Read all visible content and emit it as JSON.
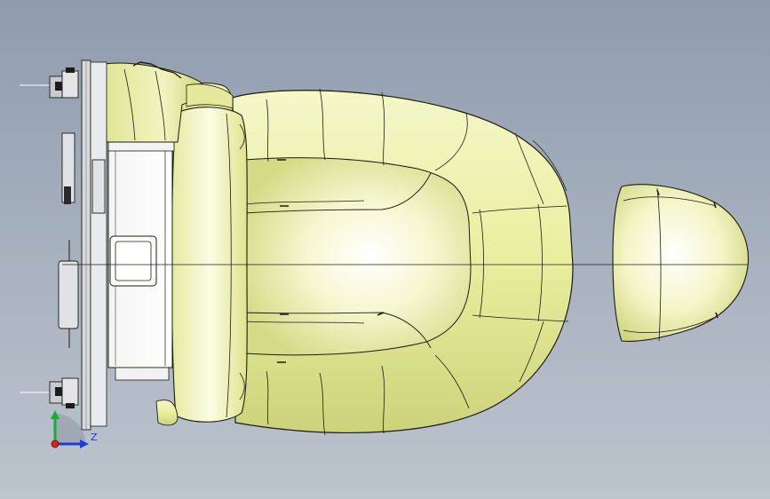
{
  "viewport": {
    "background_top": "#8f9cae",
    "background_bottom": "#bcc4cd"
  },
  "model": {
    "surface_color": "#eef2b4",
    "surface_shade": "#c8cf74",
    "edge_color": "#1c1c10",
    "bracket_color": "#d7d9de"
  },
  "triad": {
    "z_label": "Z",
    "x_color": "#e02020",
    "y_color": "#12b030",
    "z_color": "#1d3bd6"
  }
}
